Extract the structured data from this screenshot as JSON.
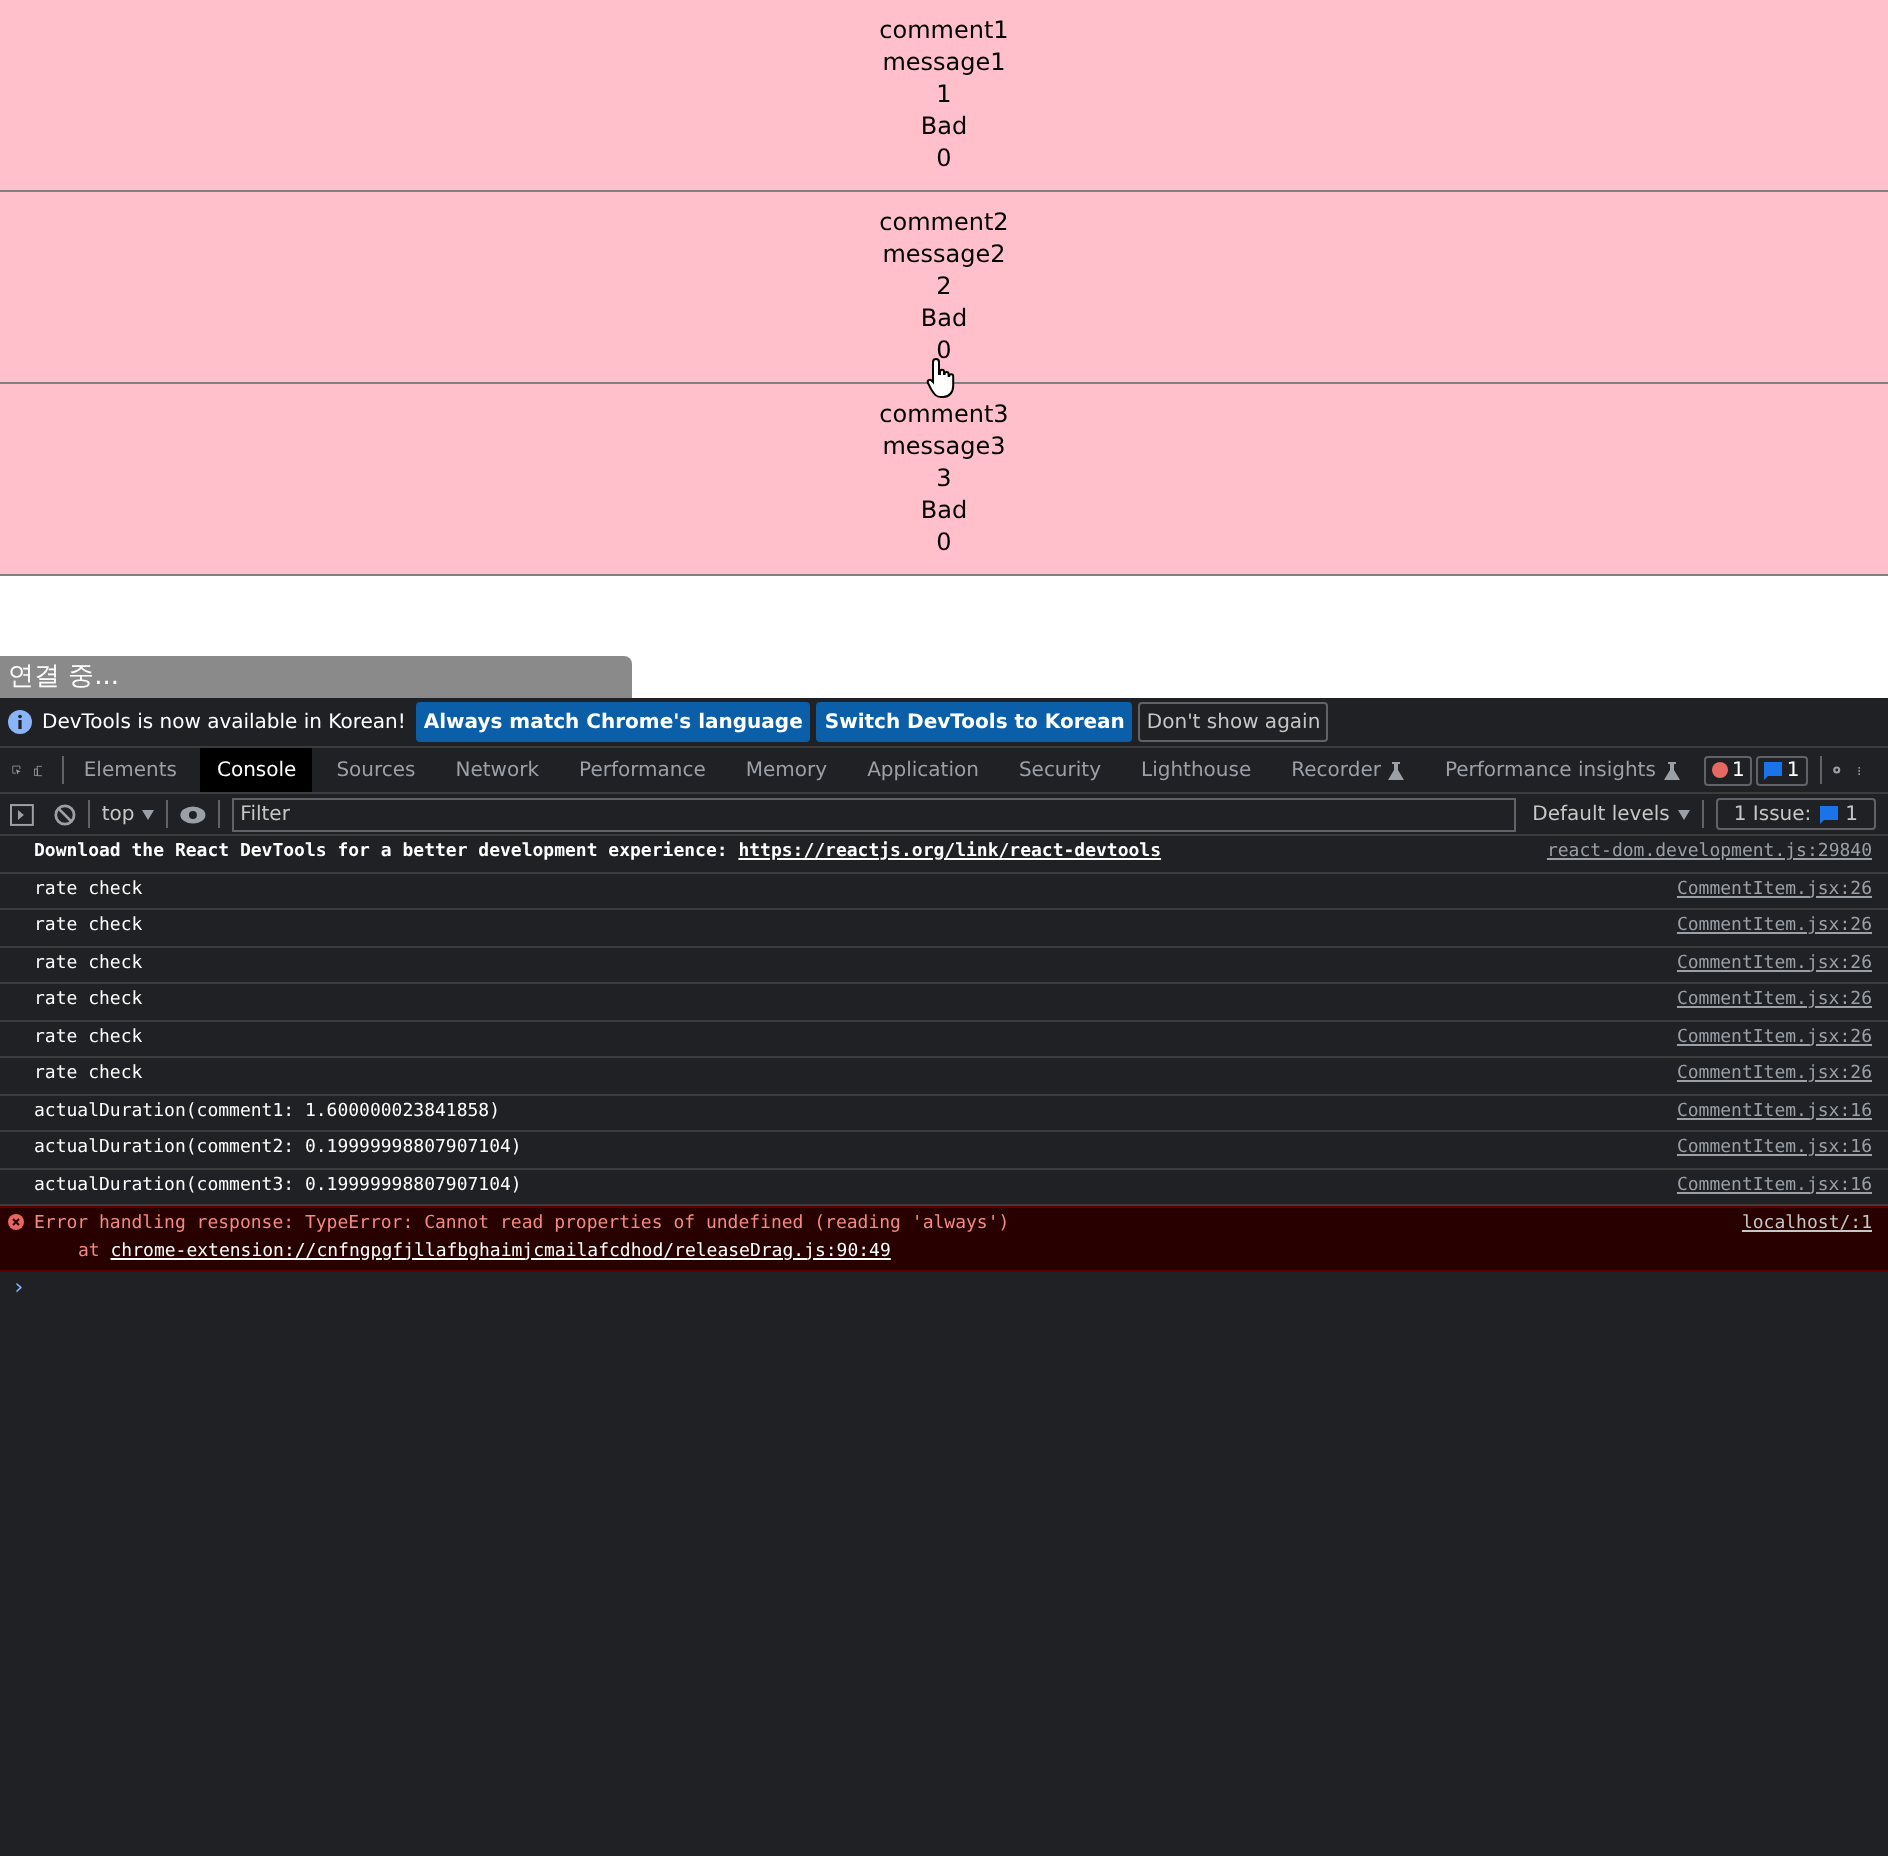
{
  "comments": [
    {
      "title": "comment1",
      "message": "message1",
      "rate": "1",
      "label": "Bad",
      "count": "0"
    },
    {
      "title": "comment2",
      "message": "message2",
      "rate": "2",
      "label": "Bad",
      "count": "0"
    },
    {
      "title": "comment3",
      "message": "message3",
      "rate": "3",
      "label": "Bad",
      "count": "0"
    }
  ],
  "status_bar": {
    "text": "연결 중..."
  },
  "devtools": {
    "infobar": {
      "message": "DevTools is now available in Korean!",
      "buttons": [
        {
          "label": "Always match Chrome's language",
          "kind": "primary"
        },
        {
          "label": "Switch DevTools to Korean",
          "kind": "primary"
        },
        {
          "label": "Don't show again",
          "kind": "secondary"
        }
      ]
    },
    "tabs": [
      {
        "label": "Elements",
        "selected": false,
        "experimental": false
      },
      {
        "label": "Console",
        "selected": true,
        "experimental": false
      },
      {
        "label": "Sources",
        "selected": false,
        "experimental": false
      },
      {
        "label": "Network",
        "selected": false,
        "experimental": false
      },
      {
        "label": "Performance",
        "selected": false,
        "experimental": false
      },
      {
        "label": "Memory",
        "selected": false,
        "experimental": false
      },
      {
        "label": "Application",
        "selected": false,
        "experimental": false
      },
      {
        "label": "Security",
        "selected": false,
        "experimental": false
      },
      {
        "label": "Lighthouse",
        "selected": false,
        "experimental": false
      },
      {
        "label": "Recorder",
        "selected": false,
        "experimental": true
      },
      {
        "label": "Performance insights",
        "selected": false,
        "experimental": true
      }
    ],
    "error_count": "1",
    "message_count": "1",
    "toolbar": {
      "context": "top",
      "filter_placeholder": "Filter",
      "levels": "Default levels",
      "issues_label": "1 Issue:",
      "issues_count": "1"
    },
    "console": [
      {
        "kind": "info",
        "text": "Download the React DevTools for a better development experience: ",
        "link": "https://reactjs.org/link/react-devtools",
        "source": "react-dom.development.js:29840"
      },
      {
        "kind": "log",
        "text": "rate check",
        "source": "CommentItem.jsx:26"
      },
      {
        "kind": "log",
        "text": "rate check",
        "source": "CommentItem.jsx:26"
      },
      {
        "kind": "log",
        "text": "rate check",
        "source": "CommentItem.jsx:26"
      },
      {
        "kind": "log",
        "text": "rate check",
        "source": "CommentItem.jsx:26"
      },
      {
        "kind": "log",
        "text": "rate check",
        "source": "CommentItem.jsx:26"
      },
      {
        "kind": "log",
        "text": "rate check",
        "source": "CommentItem.jsx:26"
      },
      {
        "kind": "log",
        "text": "actualDuration(comment1: 1.600000023841858)",
        "source": "CommentItem.jsx:16"
      },
      {
        "kind": "log",
        "text": "actualDuration(comment2: 0.19999998807907104)",
        "source": "CommentItem.jsx:16"
      },
      {
        "kind": "log",
        "text": "actualDuration(comment3: 0.19999998807907104)",
        "source": "CommentItem.jsx:16"
      },
      {
        "kind": "error",
        "text": "Error handling response: TypeError: Cannot read properties of undefined (reading 'always')",
        "stack_prefix": "at ",
        "link": "chrome-extension://cnfngpgfjllafbghaimjcmailafcdhod/releaseDrag.js:90:49",
        "source": "localhost/:1"
      }
    ],
    "prompt": "›"
  }
}
